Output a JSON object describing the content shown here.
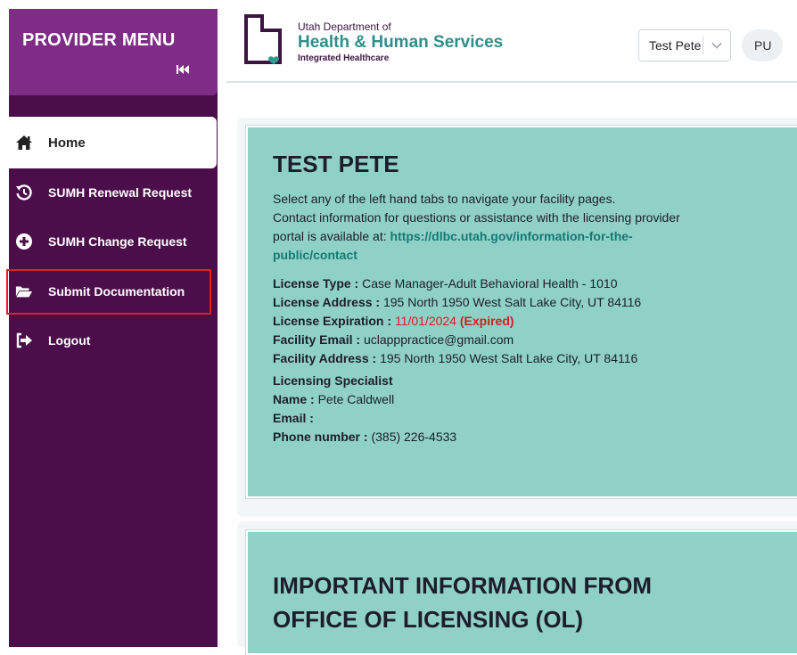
{
  "sidebar": {
    "title": "PROVIDER MENU",
    "items": [
      {
        "label": "Home"
      },
      {
        "label": "SUMH Renewal Request"
      },
      {
        "label": "SUMH Change Request"
      },
      {
        "label": "Submit Documentation"
      },
      {
        "label": "Logout"
      }
    ]
  },
  "header": {
    "logo_small": "Utah Department of",
    "logo_main": "Health & Human Services",
    "logo_sub": "Integrated Healthcare",
    "user_select_value": "Test Pete",
    "avatar_initials": "PU"
  },
  "profile": {
    "title": "TEST PETE",
    "intro_line1": "Select any of the left hand tabs to navigate your facility pages.",
    "intro_line2": "Contact information for questions or assistance with the licensing provider",
    "intro_line3_prefix": "portal is available at: ",
    "link_part1": "https://dlbc.utah.gov/information-for-the-",
    "link_part2": "public/contact",
    "license_type_label": "License Type :",
    "license_type_value": "Case Manager-Adult Behavioral Health - 1010",
    "license_address_label": "License Address :",
    "license_address_value": "195 North 1950 West Salt Lake City, UT 84116",
    "license_expiration_label": "License Expiration :",
    "license_expiration_value": "11/01/2024",
    "license_expiration_status": "(Expired)",
    "facility_email_label": "Facility Email :",
    "facility_email_value": "uclapppractice@gmail.com",
    "facility_address_label": "Facility Address :",
    "facility_address_value": "195 North 1950 West Salt Lake City, UT 84116",
    "specialist_heading": "Licensing Specialist",
    "specialist_name_label": "Name :",
    "specialist_name_value": "Pete Caldwell",
    "specialist_email_label": "Email :",
    "specialist_phone_label": "Phone number :",
    "specialist_phone_value": "(385) 226-4533"
  },
  "info": {
    "title_line1": "IMPORTANT INFORMATION FROM",
    "title_line2": "OFFICE OF LICENSING (OL)"
  },
  "colors": {
    "sidebar_bg": "#4b0e4a",
    "sidebar_header_bg": "#7e2c86",
    "panel_bg": "#90d1c7",
    "link": "#137a74",
    "expired": "#d02020",
    "highlight": "#e02020"
  },
  "icons": {
    "collapse": "skip-back-icon",
    "home": "home-icon",
    "renewal": "history-icon",
    "change": "plus-circle-icon",
    "documentation": "folder-open-icon",
    "logout": "sign-out-icon",
    "dropdown": "chevron-down-icon"
  }
}
